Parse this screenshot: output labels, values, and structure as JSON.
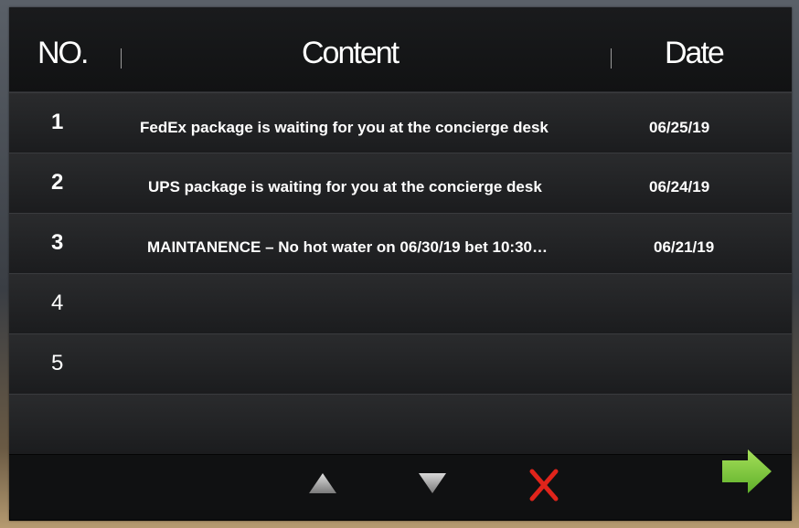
{
  "table": {
    "headers": {
      "no": "NO.",
      "content": "Content",
      "date": "Date"
    },
    "rows": [
      {
        "no": "1",
        "content": "FedEx  package is waiting for you at the concierge desk",
        "date": "06/25/19"
      },
      {
        "no": "2",
        "content": "UPS  package is waiting for you at the concierge desk",
        "date": "06/24/19"
      },
      {
        "no": "3",
        "content": "MAINTANENCE – No hot water on 06/30/19 bet 10:30…",
        "date": "06/21/19"
      },
      {
        "no": "4",
        "content": "",
        "date": ""
      },
      {
        "no": "5",
        "content": "",
        "date": ""
      }
    ]
  },
  "toolbar": {
    "up": {
      "icon": "triangle-up-icon",
      "color": "#9a9a9a"
    },
    "down": {
      "icon": "triangle-down-icon",
      "color": "#9a9a9a"
    },
    "delete": {
      "icon": "close-icon",
      "color": "#e0241b"
    },
    "next": {
      "icon": "arrow-right-icon",
      "color": "#7ccb3a"
    }
  }
}
